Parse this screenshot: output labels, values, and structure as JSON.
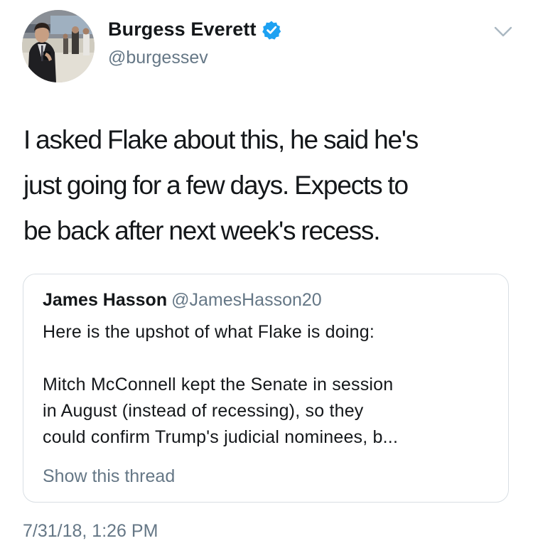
{
  "tweet": {
    "author": {
      "display_name": "Burgess Everett",
      "handle": "@burgessev",
      "verified": true
    },
    "text_lines": [
      "I asked Flake about this, he said he's",
      "just going for a few days. Expects to",
      "be back after next week's recess."
    ],
    "timestamp": "7/31/18, 1:26 PM",
    "quoted_tweet": {
      "display_name": "James Hasson",
      "handle": "@JamesHasson20",
      "text_paragraphs": [
        [
          "Here is the upshot of what Flake is doing:"
        ],
        [
          "Mitch McConnell kept the Senate in session",
          "in August (instead of recessing), so they",
          "could confirm Trump's judicial nominees, b..."
        ]
      ],
      "show_thread_label": "Show this thread"
    }
  },
  "icons": {
    "verified": "verified-badge-icon",
    "menu": "chevron-down-icon"
  },
  "colors": {
    "text_primary": "#14171a",
    "text_secondary": "#657786",
    "verified_blue": "#1da1f2",
    "card_border": "#d9dfe4",
    "chevron": "#aab8c2"
  }
}
